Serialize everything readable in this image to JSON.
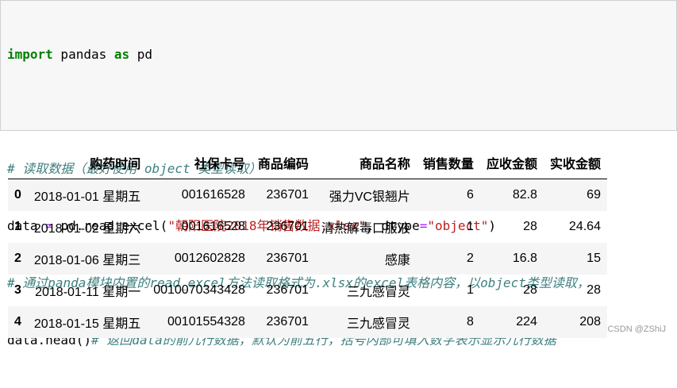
{
  "code": {
    "line1": {
      "kw_import": "import",
      "mod": " pandas ",
      "kw_as": "as",
      "alias": " pd"
    },
    "line3": "# 读取数据（最好使用 object 类型读取）",
    "line4": {
      "pre": "data ",
      "op1": "=",
      "mid": " pd.read_excel(",
      "str1": "\"朝阳医院2018年销售数据.xlsx\"",
      "sep": ", dtype",
      "op2": "=",
      "str2": "\"object\"",
      "end": ")"
    },
    "line5": "# 通过panda模块内置的read_excel方法读取格式为.xlsx的excel表格内容，以object类型读取，",
    "line6": {
      "pre": "data.head()",
      "comment": "# 返回data的前几行数据，默认为前五行，括号内部可填入数字表示显示几行数据"
    }
  },
  "table": {
    "columns": [
      "购药时间",
      "社保卡号",
      "商品编码",
      "商品名称",
      "销售数量",
      "应收金额",
      "实收金额"
    ],
    "rows": [
      {
        "index": "0",
        "cells": [
          "2018-01-01 星期五",
          "001616528",
          "236701",
          "强力VC银翘片",
          "6",
          "82.8",
          "69"
        ]
      },
      {
        "index": "1",
        "cells": [
          "2018-01-02 星期六",
          "001616528",
          "236701",
          "清热解毒口服液",
          "1",
          "28",
          "24.64"
        ]
      },
      {
        "index": "2",
        "cells": [
          "2018-01-06 星期三",
          "0012602828",
          "236701",
          "感康",
          "2",
          "16.8",
          "15"
        ]
      },
      {
        "index": "3",
        "cells": [
          "2018-01-11 星期一",
          "0010070343428",
          "236701",
          "三九感冒灵",
          "1",
          "28",
          "28"
        ]
      },
      {
        "index": "4",
        "cells": [
          "2018-01-15 星期五",
          "00101554328",
          "236701",
          "三九感冒灵",
          "8",
          "224",
          "208"
        ]
      }
    ]
  },
  "watermark": "CSDN @ZShiJ"
}
